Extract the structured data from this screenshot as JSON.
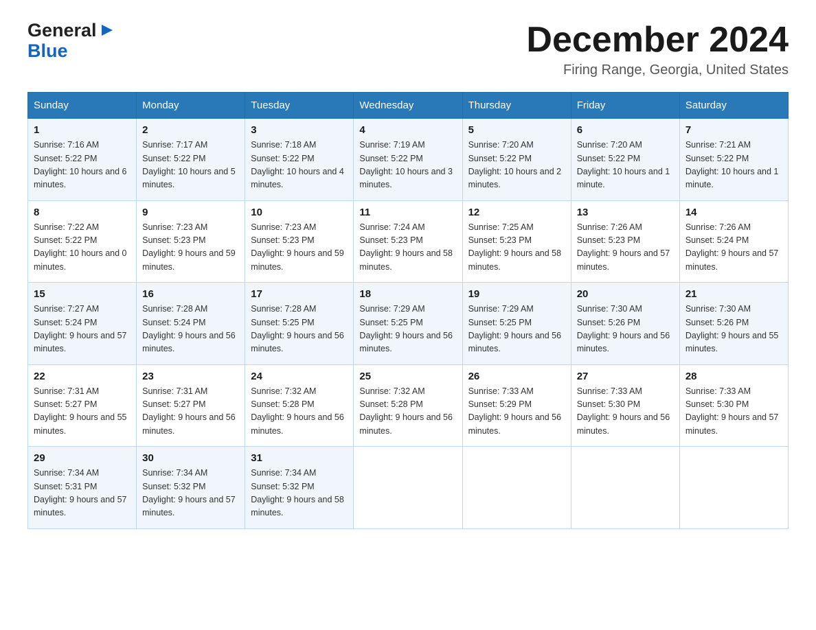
{
  "header": {
    "logo_line1": "General",
    "logo_line2": "Blue",
    "month_title": "December 2024",
    "subtitle": "Firing Range, Georgia, United States"
  },
  "weekdays": [
    "Sunday",
    "Monday",
    "Tuesday",
    "Wednesday",
    "Thursday",
    "Friday",
    "Saturday"
  ],
  "weeks": [
    [
      {
        "day": "1",
        "sunrise": "7:16 AM",
        "sunset": "5:22 PM",
        "daylight": "10 hours and 6 minutes."
      },
      {
        "day": "2",
        "sunrise": "7:17 AM",
        "sunset": "5:22 PM",
        "daylight": "10 hours and 5 minutes."
      },
      {
        "day": "3",
        "sunrise": "7:18 AM",
        "sunset": "5:22 PM",
        "daylight": "10 hours and 4 minutes."
      },
      {
        "day": "4",
        "sunrise": "7:19 AM",
        "sunset": "5:22 PM",
        "daylight": "10 hours and 3 minutes."
      },
      {
        "day": "5",
        "sunrise": "7:20 AM",
        "sunset": "5:22 PM",
        "daylight": "10 hours and 2 minutes."
      },
      {
        "day": "6",
        "sunrise": "7:20 AM",
        "sunset": "5:22 PM",
        "daylight": "10 hours and 1 minute."
      },
      {
        "day": "7",
        "sunrise": "7:21 AM",
        "sunset": "5:22 PM",
        "daylight": "10 hours and 1 minute."
      }
    ],
    [
      {
        "day": "8",
        "sunrise": "7:22 AM",
        "sunset": "5:22 PM",
        "daylight": "10 hours and 0 minutes."
      },
      {
        "day": "9",
        "sunrise": "7:23 AM",
        "sunset": "5:23 PM",
        "daylight": "9 hours and 59 minutes."
      },
      {
        "day": "10",
        "sunrise": "7:23 AM",
        "sunset": "5:23 PM",
        "daylight": "9 hours and 59 minutes."
      },
      {
        "day": "11",
        "sunrise": "7:24 AM",
        "sunset": "5:23 PM",
        "daylight": "9 hours and 58 minutes."
      },
      {
        "day": "12",
        "sunrise": "7:25 AM",
        "sunset": "5:23 PM",
        "daylight": "9 hours and 58 minutes."
      },
      {
        "day": "13",
        "sunrise": "7:26 AM",
        "sunset": "5:23 PM",
        "daylight": "9 hours and 57 minutes."
      },
      {
        "day": "14",
        "sunrise": "7:26 AM",
        "sunset": "5:24 PM",
        "daylight": "9 hours and 57 minutes."
      }
    ],
    [
      {
        "day": "15",
        "sunrise": "7:27 AM",
        "sunset": "5:24 PM",
        "daylight": "9 hours and 57 minutes."
      },
      {
        "day": "16",
        "sunrise": "7:28 AM",
        "sunset": "5:24 PM",
        "daylight": "9 hours and 56 minutes."
      },
      {
        "day": "17",
        "sunrise": "7:28 AM",
        "sunset": "5:25 PM",
        "daylight": "9 hours and 56 minutes."
      },
      {
        "day": "18",
        "sunrise": "7:29 AM",
        "sunset": "5:25 PM",
        "daylight": "9 hours and 56 minutes."
      },
      {
        "day": "19",
        "sunrise": "7:29 AM",
        "sunset": "5:25 PM",
        "daylight": "9 hours and 56 minutes."
      },
      {
        "day": "20",
        "sunrise": "7:30 AM",
        "sunset": "5:26 PM",
        "daylight": "9 hours and 56 minutes."
      },
      {
        "day": "21",
        "sunrise": "7:30 AM",
        "sunset": "5:26 PM",
        "daylight": "9 hours and 55 minutes."
      }
    ],
    [
      {
        "day": "22",
        "sunrise": "7:31 AM",
        "sunset": "5:27 PM",
        "daylight": "9 hours and 55 minutes."
      },
      {
        "day": "23",
        "sunrise": "7:31 AM",
        "sunset": "5:27 PM",
        "daylight": "9 hours and 56 minutes."
      },
      {
        "day": "24",
        "sunrise": "7:32 AM",
        "sunset": "5:28 PM",
        "daylight": "9 hours and 56 minutes."
      },
      {
        "day": "25",
        "sunrise": "7:32 AM",
        "sunset": "5:28 PM",
        "daylight": "9 hours and 56 minutes."
      },
      {
        "day": "26",
        "sunrise": "7:33 AM",
        "sunset": "5:29 PM",
        "daylight": "9 hours and 56 minutes."
      },
      {
        "day": "27",
        "sunrise": "7:33 AM",
        "sunset": "5:30 PM",
        "daylight": "9 hours and 56 minutes."
      },
      {
        "day": "28",
        "sunrise": "7:33 AM",
        "sunset": "5:30 PM",
        "daylight": "9 hours and 57 minutes."
      }
    ],
    [
      {
        "day": "29",
        "sunrise": "7:34 AM",
        "sunset": "5:31 PM",
        "daylight": "9 hours and 57 minutes."
      },
      {
        "day": "30",
        "sunrise": "7:34 AM",
        "sunset": "5:32 PM",
        "daylight": "9 hours and 57 minutes."
      },
      {
        "day": "31",
        "sunrise": "7:34 AM",
        "sunset": "5:32 PM",
        "daylight": "9 hours and 58 minutes."
      },
      null,
      null,
      null,
      null
    ]
  ]
}
